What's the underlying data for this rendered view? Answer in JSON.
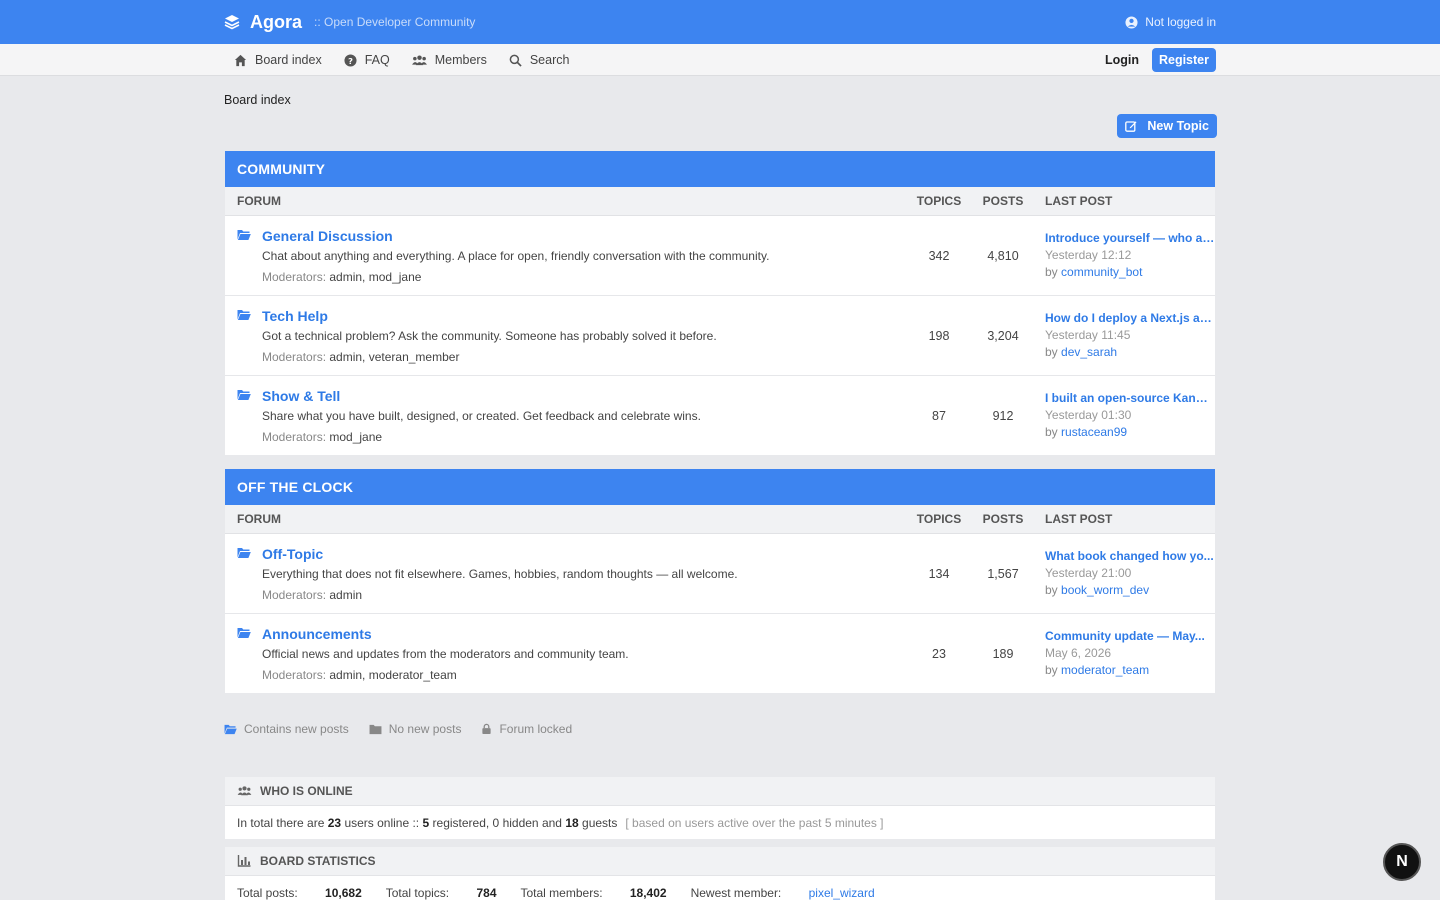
{
  "header": {
    "brand": "Agora",
    "tagline": ":: Open Developer Community",
    "user_status": "Not logged in"
  },
  "nav": {
    "items": [
      {
        "label": "Board index",
        "icon": "home-icon"
      },
      {
        "label": "FAQ",
        "icon": "question-icon"
      },
      {
        "label": "Members",
        "icon": "members-icon"
      },
      {
        "label": "Search",
        "icon": "search-icon"
      }
    ],
    "login": "Login",
    "register": "Register"
  },
  "breadcrumb": "Board index",
  "new_topic": "New Topic",
  "columns": {
    "forum": "FORUM",
    "topics": "TOPICS",
    "posts": "POSTS",
    "last_post": "LAST POST"
  },
  "categories": [
    {
      "title": "COMMUNITY",
      "forums": [
        {
          "title": "General Discussion",
          "description": "Chat about anything and everything. A place for open, friendly conversation with the community.",
          "mods_label": "Moderators:",
          "mods": "admin, mod_jane",
          "topics": "342",
          "posts": "4,810",
          "last_title": "Introduce yourself — who ar...",
          "last_date": "Yesterday 12:12",
          "by": "by",
          "last_user": "community_bot"
        },
        {
          "title": "Tech Help",
          "description": "Got a technical problem? Ask the community. Someone has probably solved it before.",
          "mods_label": "Moderators:",
          "mods": "admin, veteran_member",
          "topics": "198",
          "posts": "3,204",
          "last_title": "How do I deploy a Next.js ap...",
          "last_date": "Yesterday 11:45",
          "by": "by",
          "last_user": "dev_sarah"
        },
        {
          "title": "Show & Tell",
          "description": "Share what you have built, designed, or created. Get feedback and celebrate wins.",
          "mods_label": "Moderators:",
          "mods": "mod_jane",
          "topics": "87",
          "posts": "912",
          "last_title": "I built an open-source Kanba...",
          "last_date": "Yesterday 01:30",
          "by": "by",
          "last_user": "rustacean99"
        }
      ]
    },
    {
      "title": "OFF THE CLOCK",
      "forums": [
        {
          "title": "Off-Topic",
          "description": "Everything that does not fit elsewhere. Games, hobbies, random thoughts — all welcome.",
          "mods_label": "Moderators:",
          "mods": "admin",
          "topics": "134",
          "posts": "1,567",
          "last_title": "What book changed how yo...",
          "last_date": "Yesterday 21:00",
          "by": "by",
          "last_user": "book_worm_dev"
        },
        {
          "title": "Announcements",
          "description": "Official news and updates from the moderators and community team.",
          "mods_label": "Moderators:",
          "mods": "admin, moderator_team",
          "topics": "23",
          "posts": "189",
          "last_title": "Community update — May...",
          "last_date": "May 6, 2026",
          "by": "by",
          "last_user": "moderator_team"
        }
      ]
    }
  ],
  "legend": {
    "new_posts": "Contains new posts",
    "no_new_posts": "No new posts",
    "locked": "Forum locked"
  },
  "online": {
    "title": "WHO IS ONLINE",
    "prefix": "In total there are",
    "total": "23",
    "mid1": "users online ::",
    "registered": "5",
    "mid2": "registered, 0 hidden and",
    "guests": "18",
    "mid3": "guests",
    "note": "[ based on users active over the past 5 minutes ]"
  },
  "stats": {
    "title": "BOARD STATISTICS",
    "posts_label": "Total posts:",
    "posts": "10,682",
    "topics_label": "Total topics:",
    "topics": "784",
    "members_label": "Total members:",
    "members": "18,402",
    "newest_label": "Newest member:",
    "newest": "pixel_wizard"
  },
  "badge": "N",
  "colors": {
    "accent": "#3d84f0",
    "link": "#2e7ae6",
    "background": "#e8e9ec"
  }
}
